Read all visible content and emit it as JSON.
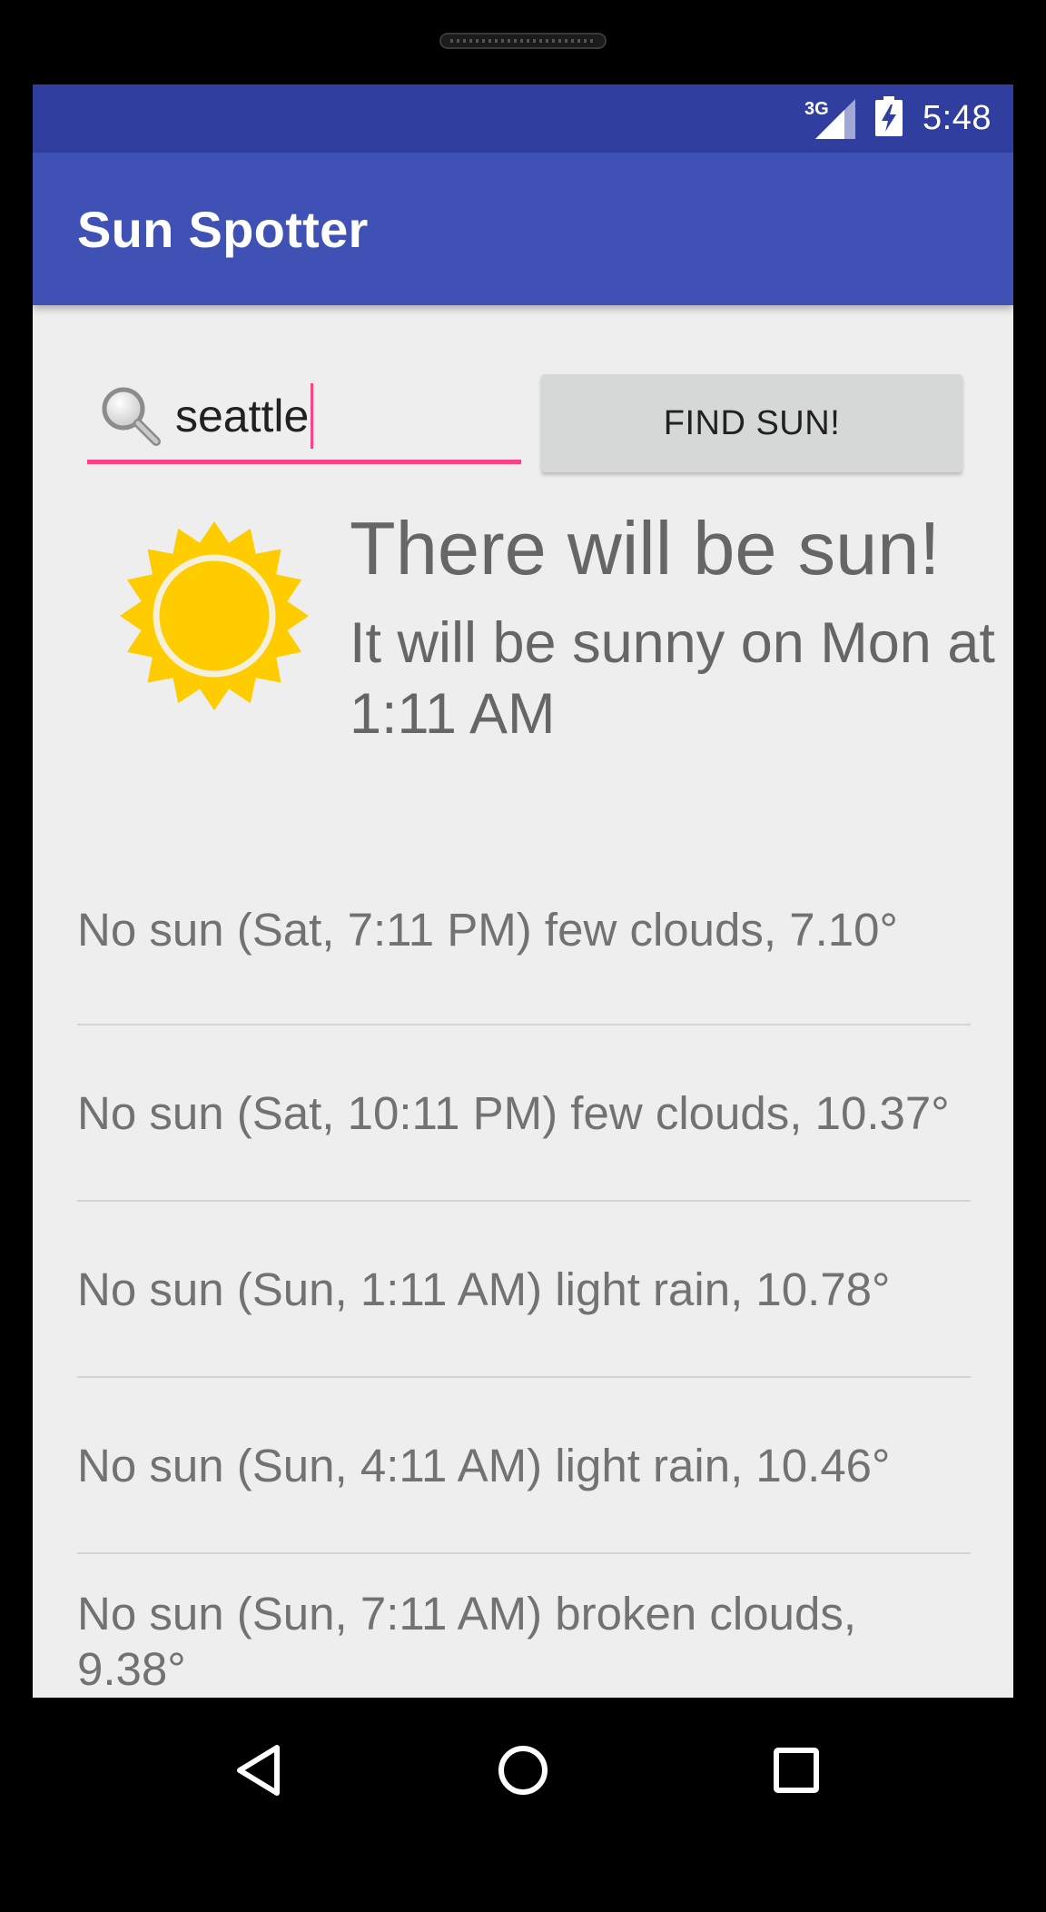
{
  "status_bar": {
    "network_type": "3G",
    "time": "5:48",
    "signal_icon": "signal-icon",
    "battery_icon": "battery-charging-icon"
  },
  "app_bar": {
    "title": "Sun Spotter"
  },
  "search": {
    "value": "seattle",
    "icon": "search-icon"
  },
  "find_button": {
    "label": "FIND SUN!"
  },
  "result": {
    "icon": "sun-icon",
    "headline": "There will be sun!",
    "subline": "It will be sunny on Mon at 1:11 AM"
  },
  "forecast": [
    "No sun (Sat, 7:11 PM) few clouds, 7.10°",
    "No sun (Sat, 10:11 PM) few clouds, 10.37°",
    "No sun (Sun, 1:11 AM) light rain, 10.78°",
    "No sun (Sun, 4:11 AM) light rain, 10.46°",
    "No sun (Sun, 7:11 AM) broken clouds, 9.38°"
  ],
  "nav_bar": {
    "back_icon": "back-icon",
    "home_icon": "home-icon",
    "recents_icon": "recents-icon"
  },
  "colors": {
    "status_bar": "#303f9f",
    "app_bar": "#3f51b5",
    "accent": "#ff4081",
    "background": "#eeeeee",
    "sun": "#ffcc00"
  }
}
